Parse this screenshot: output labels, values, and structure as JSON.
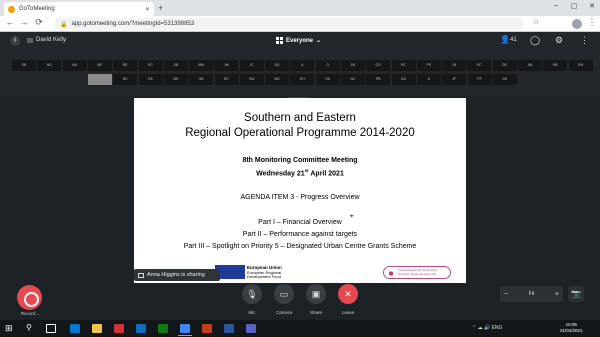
{
  "browser": {
    "tab_title": "GoToMeeting",
    "tab_close": "✕",
    "new_tab": "+",
    "win_controls": [
      "–",
      "▢",
      "✕"
    ],
    "nav": {
      "back": "←",
      "forward": "→",
      "reload": "⟳"
    },
    "lock_icon": "🔒",
    "url": "app.gotomeeting.com/?meetingId=531398853",
    "star": "☆",
    "menu": "⋮"
  },
  "meeting_header": {
    "info": "i",
    "user_name": "David Kelly",
    "view_label": "Everyone",
    "view_chevron": "⌄",
    "participants_icon": "👤",
    "participants_count": "41",
    "chat_icon": "◯",
    "settings_icon": "⚙",
    "more_icon": "⋮"
  },
  "thumbnails": {
    "row1": [
      "SB",
      "ND",
      "AM",
      "MF",
      "RE",
      "EC",
      "SB",
      "MM",
      "JM",
      "JC",
      "DS",
      "A",
      "G",
      "JM",
      "GO",
      "RC",
      "PS",
      "LB",
      "EC",
      "DD",
      "AB",
      "RB",
      "SW"
    ],
    "row2": [
      "video",
      "NC",
      "DK",
      "MK",
      "SB",
      "RC",
      "SM",
      "MD",
      "EO",
      "SD",
      "DC",
      "PB",
      "DG",
      "D",
      "JF",
      "PF",
      "JM"
    ]
  },
  "slide": {
    "title_line1": "Southern and Eastern",
    "title_line2": "Regional Operational Programme 2014-2020",
    "meeting_line": "8th Monitoring Committee Meeting",
    "date_prefix": "Wednesday 21",
    "date_sup": "st",
    "date_suffix": " April 2021",
    "agenda": "AGENDA ITEM 3 - Progress Overview",
    "part1": "Part I – Financial Overview",
    "part2": "Part II – Performance against targets",
    "part3": "Part III – Spotlight on Priority 5 – Designated Urban Centre Grants Scheme",
    "eu_line1": "European Union",
    "eu_line2": "European Regional",
    "eu_line3": "Development Fund",
    "right_logo_line1": "Tionól Réigiúnach an Deiscirt",
    "right_logo_line2": "Southern Regional Assembly",
    "cursor": "⌖"
  },
  "sharing_badge": "Anna Higgins is sharing",
  "controls": {
    "record_label": "Record...",
    "mic_label": "Mic",
    "camera_label": "Camera",
    "share_label": "Share",
    "leave_label": "Leave",
    "mic_icon": "🎙",
    "camera_icon": "▭",
    "share_icon": "▣",
    "leave_icon": "✕",
    "zoom_out": "−",
    "zoom_fit": "Fit",
    "zoom_in": "+",
    "screenshot_icon": "📷"
  },
  "taskbar": {
    "start": "⊞",
    "search": "⚲",
    "tray": "⌃  ☁  🔊  ENG",
    "time": "10:05",
    "date": "21/04/2021"
  }
}
